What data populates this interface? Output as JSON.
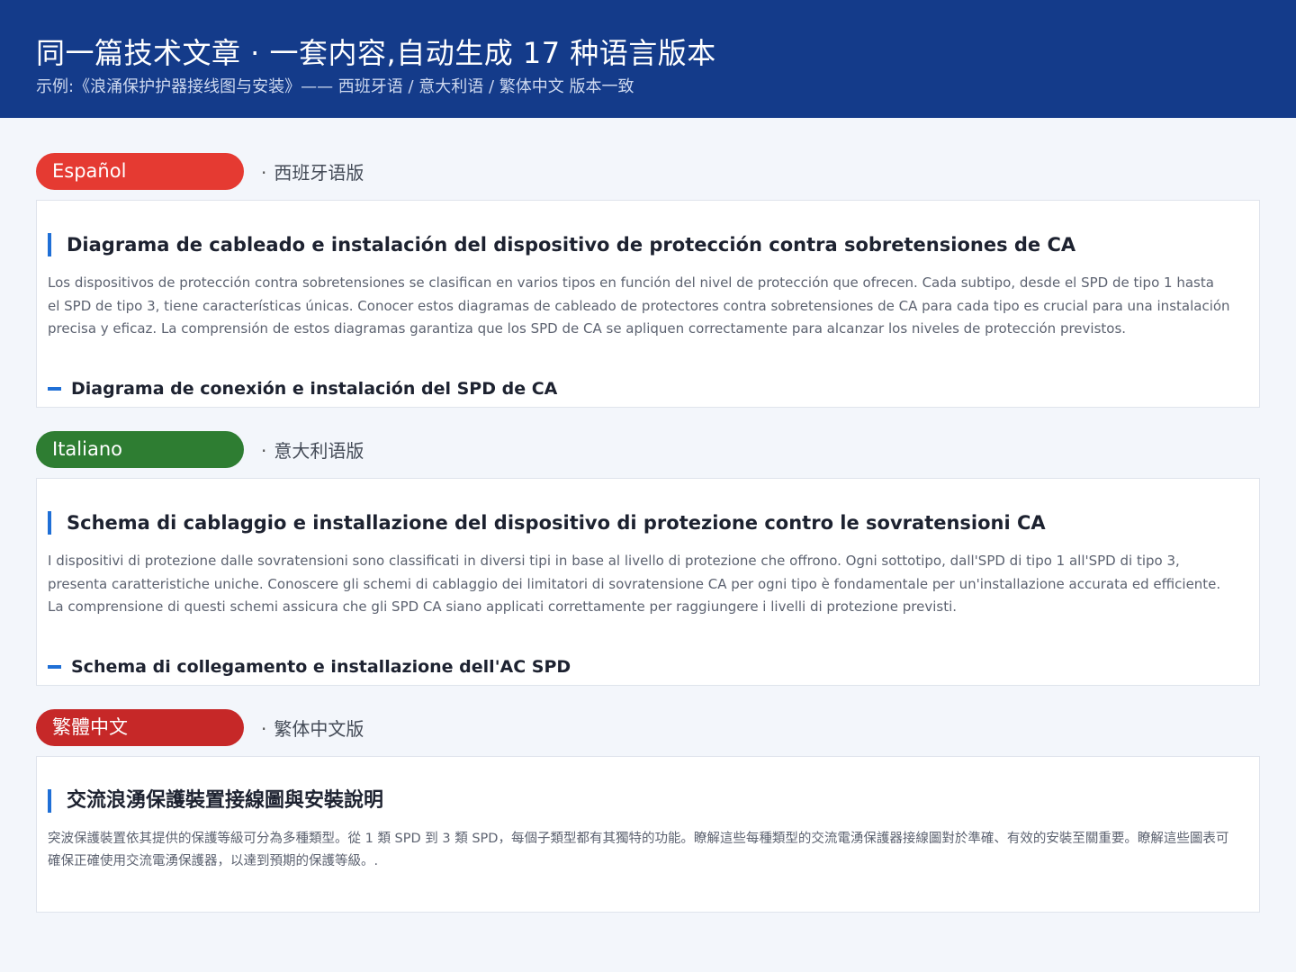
{
  "header": {
    "title": "同一篇技术文章 · 一套内容,自动生成 17 种语言版本",
    "subtitle": "示例:《浪涌保护护器接线图与安装》—— 西班牙语 / 意大利语 / 繁体中文 版本一致"
  },
  "sections": [
    {
      "pill_label": "Español",
      "pill_color": "#e53a32",
      "note": "西班牙语版",
      "title": "Diagrama de cableado e instalación del dispositivo de protección contra sobretensiones de CA",
      "body": "Los dispositivos de protección contra sobretensiones se clasifican en varios tipos en función del nivel de protección que ofrecen. Cada subtipo, desde el SPD de tipo 1 hasta el SPD de tipo 3, tiene características únicas. Conocer estos diagramas de cableado de protectores contra sobretensiones de CA para cada tipo es crucial para una instalación precisa y eficaz. La comprensión de estos diagramas garantiza que los SPD de CA se apliquen correctamente para alcanzar los niveles de protección previstos.",
      "subheading": "Diagrama de conexión e instalación del SPD de CA"
    },
    {
      "pill_label": "Italiano",
      "pill_color": "#2e7d32",
      "note": "意大利语版",
      "title": "Schema di cablaggio e installazione del dispositivo di protezione contro le sovratensioni CA",
      "body": "I dispositivi di protezione dalle sovratensioni sono classificati in diversi tipi in base al livello di protezione che offrono. Ogni sottotipo, dall'SPD di tipo 1 all'SPD di tipo 3, presenta caratteristiche uniche. Conoscere gli schemi di cablaggio dei limitatori di sovratensione CA per ogni tipo è fondamentale per un'installazione accurata ed efficiente. La comprensione di questi schemi assicura che gli SPD CA siano applicati correttamente per raggiungere i livelli di protezione previsti.",
      "subheading": "Schema di collegamento e installazione dell'AC SPD"
    },
    {
      "pill_label": "繁體中文",
      "pill_color": "#c62828",
      "note": "繁体中文版",
      "title": "交流浪湧保護裝置接線圖與安裝說明",
      "body": "突波保護裝置依其提供的保護等級可分為多種類型。從 1 類 SPD 到 3 類 SPD，每個子類型都有其獨特的功能。瞭解這些每種類型的交流電湧保護器接線圖對於準確、有效的安裝至關重要。瞭解這些圖表可確保正確使用交流電湧保護器，以達到預期的保護等級。."
    }
  ]
}
